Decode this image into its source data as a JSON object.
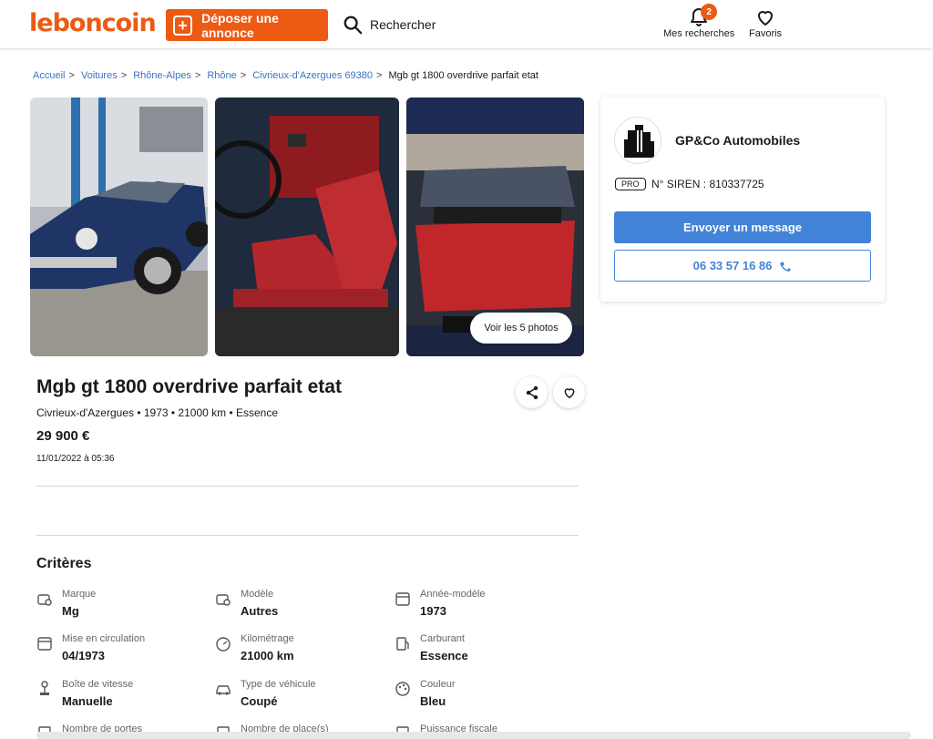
{
  "header": {
    "logo": "leboncoin",
    "post_button": "Déposer une annonce",
    "search_label": "Rechercher",
    "my_searches_label": "Mes recherches",
    "my_searches_badge": "2",
    "favorites_label": "Favoris"
  },
  "breadcrumb": {
    "items": [
      "Accueil",
      "Voitures",
      "Rhône-Alpes",
      "Rhône",
      "Civrieux-d'Azergues 69380"
    ],
    "current": "Mgb gt 1800 overdrive parfait etat"
  },
  "gallery": {
    "see_photos_button": "Voir les 5 photos"
  },
  "ad": {
    "title": "Mgb gt 1800 overdrive parfait etat",
    "subtitle": "Civrieux-d'Azergues • 1973 • 21000 km • Essence",
    "price": "29 900 €",
    "date": "11/01/2022 à 05:36"
  },
  "criteria": {
    "title": "Critères",
    "items": [
      {
        "label": "Marque",
        "value": "Mg",
        "icon": "car-brand-icon"
      },
      {
        "label": "Modèle",
        "value": "Autres",
        "icon": "car-model-icon"
      },
      {
        "label": "Année-modèle",
        "value": "1973",
        "icon": "calendar-icon"
      },
      {
        "label": "Mise en circulation",
        "value": "04/1973",
        "icon": "calendar-icon"
      },
      {
        "label": "Kilométrage",
        "value": "21000 km",
        "icon": "speedometer-icon"
      },
      {
        "label": "Carburant",
        "value": "Essence",
        "icon": "fuel-icon"
      },
      {
        "label": "Boîte de vitesse",
        "value": "Manuelle",
        "icon": "gearshift-icon"
      },
      {
        "label": "Type de véhicule",
        "value": "Coupé",
        "icon": "car-type-icon"
      },
      {
        "label": "Couleur",
        "value": "Bleu",
        "icon": "palette-icon"
      },
      {
        "label": "Nombre de portes",
        "value": "",
        "icon": "door-icon"
      },
      {
        "label": "Nombre de place(s)",
        "value": "",
        "icon": "seat-icon"
      },
      {
        "label": "Puissance fiscale",
        "value": "",
        "icon": "power-icon"
      }
    ]
  },
  "seller": {
    "name": "GP&Co Automobiles",
    "pro_badge": "PRO",
    "siren": "N° SIREN : 810337725",
    "message_button": "Envoyer un message",
    "phone": "06 33 57 16 86"
  },
  "colors": {
    "brand": "#ec5a13",
    "link": "#3a73c2",
    "primary_button": "#4183d7"
  }
}
